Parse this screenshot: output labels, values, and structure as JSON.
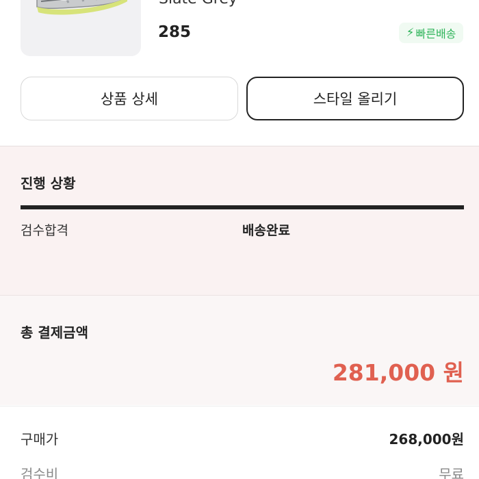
{
  "product": {
    "name": "Slate Grey",
    "size": "285",
    "fast_badge_label": "빠른배송"
  },
  "actions": {
    "detail_label": "상품 상세",
    "style_label": "스타일 올리기"
  },
  "progress": {
    "title": "진행 상황",
    "step_inspection": "검수합격",
    "step_delivered": "배송완료"
  },
  "total": {
    "title": "총 결제금액",
    "amount": "281,000 원"
  },
  "breakdown": {
    "price_label": "구매가",
    "price_value": "268,000원",
    "fee_label": "검수비",
    "fee_value": "무료"
  },
  "colors": {
    "accent_red": "#e06050",
    "fast_green": "#2fb45a",
    "progress_bg": "#faf2f2"
  }
}
